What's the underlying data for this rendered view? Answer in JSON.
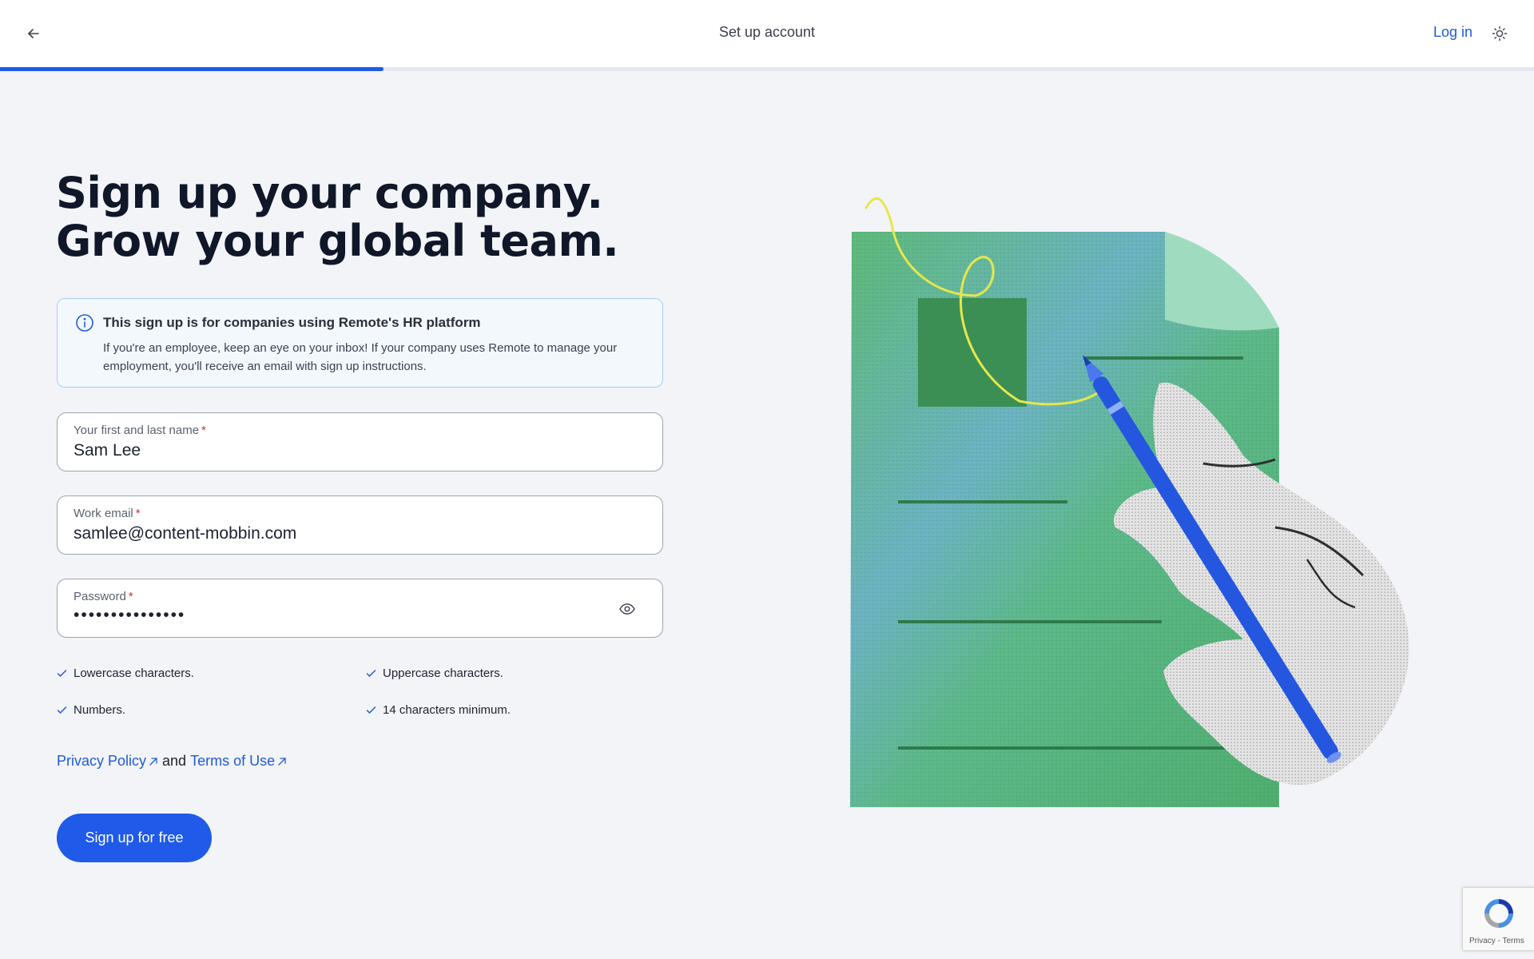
{
  "header": {
    "title": "Set up account",
    "login_label": "Log in",
    "progress_percent": 25
  },
  "hero": {
    "line1": "Sign up your company.",
    "line2": "Grow your global team."
  },
  "notice": {
    "title": "This sign up is for companies using Remote's HR platform",
    "text": "If you're an employee, keep an eye on your inbox! If your company uses Remote to manage your employment, you'll receive an email with sign up instructions."
  },
  "form": {
    "name": {
      "label": "Your first and last name",
      "required_mark": "*",
      "value": "Sam Lee"
    },
    "email": {
      "label": "Work email",
      "required_mark": "*",
      "value": "samlee@content-mobbin.com"
    },
    "password": {
      "label": "Password",
      "required_mark": "*",
      "value": "•••••••••••••••"
    }
  },
  "password_rules": [
    {
      "label": "Lowercase characters.",
      "met": true
    },
    {
      "label": "Uppercase characters.",
      "met": true
    },
    {
      "label": "Numbers.",
      "met": true
    },
    {
      "label": "14 characters minimum.",
      "met": true
    }
  ],
  "legal": {
    "privacy_label": "Privacy Policy",
    "and_text": "and",
    "terms_label": "Terms of Use"
  },
  "cta": {
    "label": "Sign up for free"
  },
  "recaptcha": {
    "links": "Privacy - Terms"
  },
  "colors": {
    "accent": "#1f5ae8",
    "link": "#1f5ad6",
    "background": "#f3f4f8",
    "required": "#d62b2b"
  }
}
